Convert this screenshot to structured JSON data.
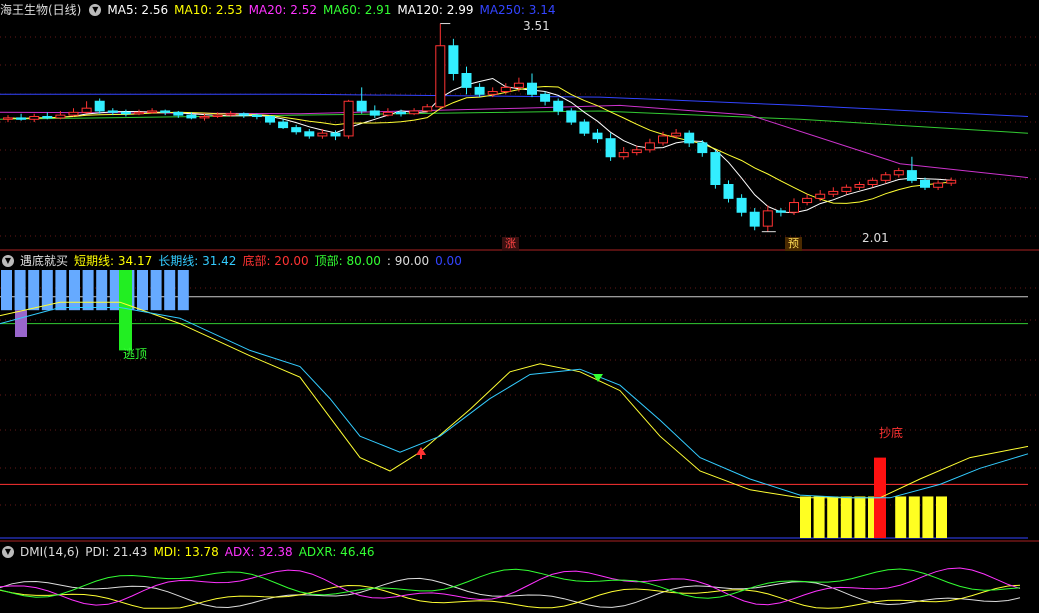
{
  "main_panel": {
    "title": "海王生物(日线)",
    "indicators": [
      {
        "label": "MA5: 2.56",
        "color": "#ffffff"
      },
      {
        "label": "MA10: 2.53",
        "color": "#ffff00"
      },
      {
        "label": "MA20: 2.52",
        "color": "#ff33ff"
      },
      {
        "label": "MA60: 2.91",
        "color": "#33ff33"
      },
      {
        "label": "MA120: 2.99",
        "color": "#ffffff"
      },
      {
        "label": "MA250: 3.14",
        "color": "#3344ff"
      }
    ],
    "high_label": "3.51",
    "low_label": "2.01",
    "tag_rise": "涨",
    "tag_pre": "预"
  },
  "indicator_panel": {
    "title": "遇底就买",
    "items": [
      {
        "label": "短期线: 34.17",
        "color": "#ffff00"
      },
      {
        "label": "长期线: 31.42",
        "color": "#33ccff"
      },
      {
        "label": "底部: 20.00",
        "color": "#ff3333"
      },
      {
        "label": "顶部: 80.00",
        "color": "#33ff33"
      },
      {
        "label": ": 90.00",
        "color": "#dddddd"
      },
      {
        "label": "0.00",
        "color": "#3344ff"
      }
    ],
    "escape_top_label": "逃顶",
    "bottom_buy_label": "抄底"
  },
  "dmi_panel": {
    "title": "DMI(14,6)",
    "items": [
      {
        "label": "PDI: 21.43",
        "color": "#dddddd"
      },
      {
        "label": "MDI: 13.78",
        "color": "#ffff00"
      },
      {
        "label": "ADX: 32.38",
        "color": "#ff33ff"
      },
      {
        "label": "ADXR: 46.46",
        "color": "#33ff33"
      }
    ]
  },
  "chart_data": {
    "type": "candlestick",
    "candles": [
      [
        2.82,
        2.83,
        2.85,
        2.8
      ],
      [
        2.83,
        2.82,
        2.86,
        2.81
      ],
      [
        2.82,
        2.84,
        2.86,
        2.8
      ],
      [
        2.84,
        2.83,
        2.87,
        2.82
      ],
      [
        2.83,
        2.85,
        2.88,
        2.82
      ],
      [
        2.85,
        2.87,
        2.9,
        2.84
      ],
      [
        2.87,
        2.9,
        2.95,
        2.86
      ],
      [
        2.95,
        2.88,
        2.97,
        2.86
      ],
      [
        2.88,
        2.87,
        2.9,
        2.85
      ],
      [
        2.87,
        2.86,
        2.89,
        2.84
      ],
      [
        2.86,
        2.87,
        2.89,
        2.85
      ],
      [
        2.87,
        2.88,
        2.9,
        2.86
      ],
      [
        2.88,
        2.87,
        2.89,
        2.85
      ],
      [
        2.87,
        2.85,
        2.88,
        2.83
      ],
      [
        2.85,
        2.83,
        2.87,
        2.82
      ],
      [
        2.83,
        2.84,
        2.86,
        2.81
      ],
      [
        2.84,
        2.85,
        2.87,
        2.83
      ],
      [
        2.85,
        2.86,
        2.88,
        2.84
      ],
      [
        2.86,
        2.85,
        2.87,
        2.83
      ],
      [
        2.85,
        2.84,
        2.86,
        2.82
      ],
      [
        2.84,
        2.8,
        2.85,
        2.78
      ],
      [
        2.8,
        2.76,
        2.82,
        2.75
      ],
      [
        2.76,
        2.73,
        2.78,
        2.71
      ],
      [
        2.73,
        2.7,
        2.75,
        2.68
      ],
      [
        2.7,
        2.72,
        2.75,
        2.68
      ],
      [
        2.72,
        2.7,
        2.74,
        2.67
      ],
      [
        2.7,
        2.95,
        2.96,
        2.68
      ],
      [
        2.95,
        2.88,
        3.05,
        2.86
      ],
      [
        2.88,
        2.85,
        2.92,
        2.83
      ],
      [
        2.85,
        2.87,
        2.9,
        2.84
      ],
      [
        2.87,
        2.86,
        2.89,
        2.84
      ],
      [
        2.86,
        2.88,
        2.9,
        2.85
      ],
      [
        2.88,
        2.91,
        2.93,
        2.87
      ],
      [
        2.91,
        3.35,
        3.51,
        2.9
      ],
      [
        3.35,
        3.15,
        3.4,
        3.1
      ],
      [
        3.15,
        3.05,
        3.2,
        3.0
      ],
      [
        3.05,
        3.0,
        3.08,
        2.98
      ],
      [
        3.0,
        3.02,
        3.05,
        2.98
      ],
      [
        3.02,
        3.05,
        3.08,
        3.0
      ],
      [
        3.05,
        3.08,
        3.12,
        3.02
      ],
      [
        3.08,
        3.0,
        3.15,
        2.98
      ],
      [
        3.0,
        2.95,
        3.02,
        2.92
      ],
      [
        2.95,
        2.88,
        2.97,
        2.85
      ],
      [
        2.88,
        2.8,
        2.9,
        2.78
      ],
      [
        2.8,
        2.72,
        2.82,
        2.7
      ],
      [
        2.72,
        2.68,
        2.75,
        2.65
      ],
      [
        2.68,
        2.55,
        2.72,
        2.52
      ],
      [
        2.55,
        2.58,
        2.62,
        2.53
      ],
      [
        2.58,
        2.6,
        2.63,
        2.56
      ],
      [
        2.6,
        2.65,
        2.68,
        2.58
      ],
      [
        2.65,
        2.7,
        2.73,
        2.63
      ],
      [
        2.7,
        2.72,
        2.75,
        2.68
      ],
      [
        2.72,
        2.65,
        2.74,
        2.62
      ],
      [
        2.65,
        2.58,
        2.67,
        2.55
      ],
      [
        2.58,
        2.35,
        2.6,
        2.32
      ],
      [
        2.35,
        2.25,
        2.38,
        2.22
      ],
      [
        2.25,
        2.15,
        2.28,
        2.12
      ],
      [
        2.15,
        2.05,
        2.18,
        2.02
      ],
      [
        2.05,
        2.16,
        2.2,
        2.01
      ],
      [
        2.16,
        2.15,
        2.18,
        2.12
      ],
      [
        2.15,
        2.22,
        2.25,
        2.13
      ],
      [
        2.22,
        2.25,
        2.28,
        2.2
      ],
      [
        2.25,
        2.28,
        2.31,
        2.23
      ],
      [
        2.28,
        2.3,
        2.33,
        2.26
      ],
      [
        2.3,
        2.33,
        2.35,
        2.28
      ],
      [
        2.33,
        2.35,
        2.37,
        2.31
      ],
      [
        2.35,
        2.38,
        2.4,
        2.33
      ],
      [
        2.38,
        2.42,
        2.44,
        2.36
      ],
      [
        2.42,
        2.45,
        2.47,
        2.4
      ],
      [
        2.45,
        2.38,
        2.55,
        2.36
      ],
      [
        2.38,
        2.33,
        2.4,
        2.31
      ],
      [
        2.33,
        2.36,
        2.38,
        2.31
      ],
      [
        2.36,
        2.38,
        2.4,
        2.34
      ]
    ]
  }
}
